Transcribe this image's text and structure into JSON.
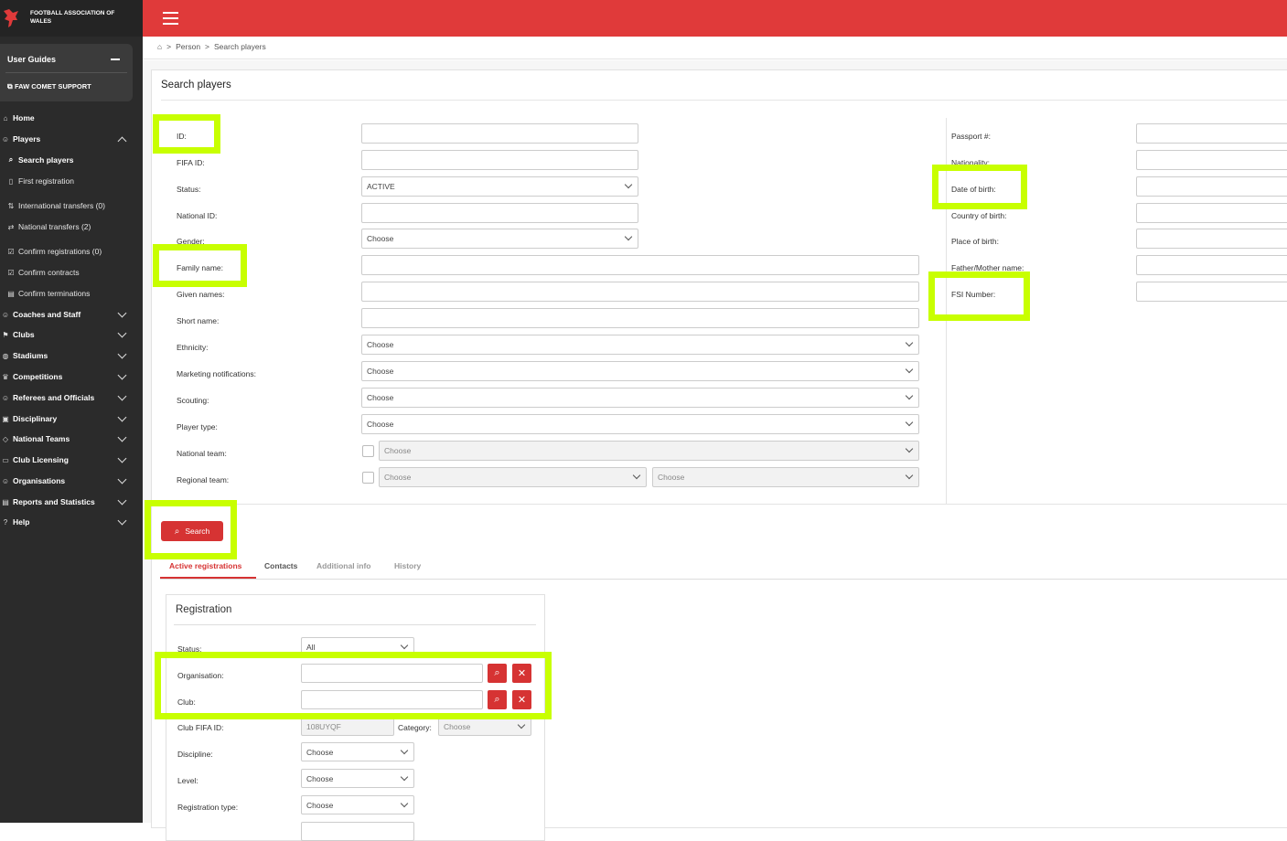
{
  "brand": {
    "name": "FOOTBALL ASSOCIATION OF WALES"
  },
  "guides": {
    "title": "User Guides",
    "support": "FAW COMET SUPPORT"
  },
  "nav": [
    {
      "label": "Home",
      "icon": "home-icon"
    },
    {
      "label": "Players",
      "icon": "players-icon"
    },
    {
      "label": "Search players",
      "icon": "search-icon"
    },
    {
      "label": "First registration",
      "icon": "file-icon"
    },
    {
      "label": "International transfers (0)",
      "icon": "transfer-icon"
    },
    {
      "label": "National transfers (2)",
      "icon": "exchange-icon"
    },
    {
      "label": "Confirm registrations (0)",
      "icon": "check-square-icon"
    },
    {
      "label": "Confirm contracts",
      "icon": "check-square-icon"
    },
    {
      "label": "Confirm terminations",
      "icon": "document-icon"
    },
    {
      "label": "Coaches and Staff",
      "icon": "coach-icon"
    },
    {
      "label": "Clubs",
      "icon": "club-icon"
    },
    {
      "label": "Stadiums",
      "icon": "stadium-icon"
    },
    {
      "label": "Competitions",
      "icon": "trophy-icon"
    },
    {
      "label": "Referees and Officials",
      "icon": "whistle-icon"
    },
    {
      "label": "Disciplinary",
      "icon": "card-icon"
    },
    {
      "label": "National Teams",
      "icon": "tag-icon"
    },
    {
      "label": "Club Licensing",
      "icon": "book-icon"
    },
    {
      "label": "Organisations",
      "icon": "organisation-icon"
    },
    {
      "label": "Reports and Statistics",
      "icon": "chart-icon"
    },
    {
      "label": "Help",
      "icon": "help-icon"
    }
  ],
  "breadcrumb": {
    "sep": ">",
    "items": [
      "Person",
      "Search players"
    ]
  },
  "page": {
    "title": "Search players"
  },
  "form": {
    "left": [
      {
        "label": "ID:",
        "value": ""
      },
      {
        "label": "FIFA ID:",
        "value": ""
      },
      {
        "label": "Status:",
        "value": "ACTIVE"
      },
      {
        "label": "National ID:",
        "value": ""
      },
      {
        "label": "Gender:",
        "value": "Choose"
      },
      {
        "label": "Family name:",
        "value": ""
      },
      {
        "label": "Given names:",
        "value": ""
      },
      {
        "label": "Short name:",
        "value": ""
      },
      {
        "label": "Ethnicity:",
        "value": "Choose"
      },
      {
        "label": "Marketing notifications:",
        "value": "Choose"
      },
      {
        "label": "Scouting:",
        "value": "Choose"
      },
      {
        "label": "Player type:",
        "value": "Choose"
      },
      {
        "label": "National team:",
        "value": "Choose"
      },
      {
        "label": "Regional team:",
        "value": "Choose",
        "value2": "Choose"
      }
    ],
    "right": [
      {
        "label": "Passport #:",
        "value": ""
      },
      {
        "label": "Nationality:",
        "value": ""
      },
      {
        "label": "Date of birth:",
        "value": ""
      },
      {
        "label": "Country of birth:",
        "value": ""
      },
      {
        "label": "Place of birth:",
        "value": ""
      },
      {
        "label": "Father/Mother name:",
        "value": ""
      },
      {
        "label": "FSI Number:",
        "value": ""
      }
    ],
    "search_label": "Search"
  },
  "tabs": [
    "Active registrations",
    "Contacts",
    "Additional info",
    "History"
  ],
  "registration": {
    "title": "Registration",
    "status_label": "Status:",
    "status_value": "All",
    "org_label": "Organisation:",
    "club_label": "Club:",
    "club_fifa_label": "Club FIFA ID:",
    "club_fifa_value": "108UYQF",
    "category_label": "Category:",
    "category_value": "Choose",
    "discipline_label": "Discipline:",
    "discipline_value": "Choose",
    "level_label": "Level:",
    "level_value": "Choose",
    "regtype_label": "Registration type:",
    "regtype_value": "Choose"
  },
  "colors": {
    "accent": "#e03a3a",
    "sidebar": "#2b2b2b",
    "highlight": "#c8ff00"
  }
}
